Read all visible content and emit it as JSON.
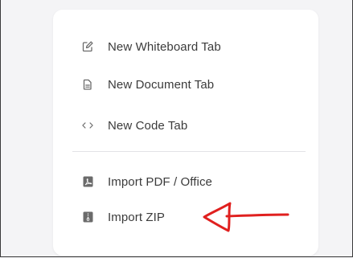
{
  "menu": {
    "items": [
      {
        "label": "New Whiteboard Tab",
        "icon": "whiteboard-edit-icon"
      },
      {
        "label": "New Document Tab",
        "icon": "document-icon"
      },
      {
        "label": "New Code Tab",
        "icon": "code-brackets-icon"
      },
      {
        "label": "Import PDF / Office",
        "icon": "pdf-file-icon"
      },
      {
        "label": "Import ZIP",
        "icon": "zip-file-icon"
      }
    ]
  },
  "annotation": {
    "color": "#e0201f",
    "kind": "hand-drawn-arrow"
  },
  "colors": {
    "background": "#f4f4f6",
    "menu_bg": "#ffffff",
    "text": "#3b3b3b",
    "icon": "#6b6b6b"
  }
}
